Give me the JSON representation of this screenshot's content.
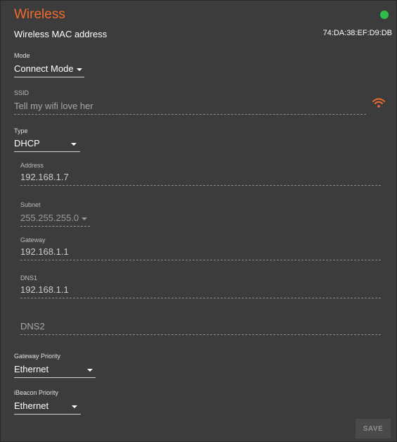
{
  "header": {
    "title": "Wireless",
    "status_color": "#2ebd4a"
  },
  "mac": {
    "label": "Wireless MAC address",
    "value": "74:DA:38:EF:D9:DB"
  },
  "mode": {
    "label": "Mode",
    "value": "Connect Mode"
  },
  "ssid": {
    "label": "SSID",
    "value": "Tell my wifi love her",
    "icon": "wifi-icon"
  },
  "type": {
    "label": "Type",
    "value": "DHCP"
  },
  "address": {
    "label": "Address",
    "value": "192.168.1.7"
  },
  "subnet": {
    "label": "Subnet",
    "value": "255.255.255.0"
  },
  "gateway": {
    "label": "Gateway",
    "value": "192.168.1.1"
  },
  "dns1": {
    "label": "DNS1",
    "value": "192.168.1.1"
  },
  "dns2": {
    "placeholder": "DNS2"
  },
  "gateway_priority": {
    "label": "Gateway Priority",
    "value": "Ethernet"
  },
  "ibeacon_priority": {
    "label": "iBeacon Priority",
    "value": "Ethernet"
  },
  "actions": {
    "save_label": "SAVE"
  },
  "colors": {
    "accent": "#f26a2e",
    "background": "#3c3c3c"
  }
}
